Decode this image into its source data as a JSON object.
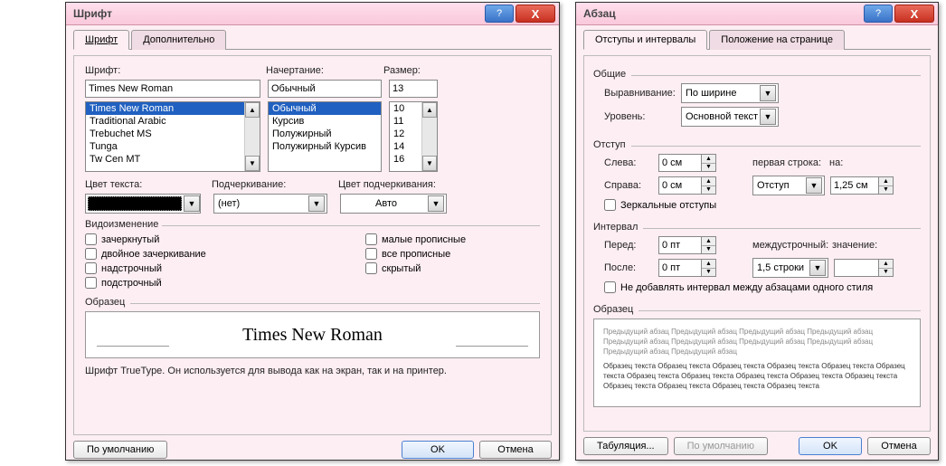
{
  "font_dialog": {
    "title": "Шрифт",
    "tabs": {
      "font": "Шрифт",
      "advanced": "Дополнительно"
    },
    "font_label": "Шрифт:",
    "style_label": "Начертание:",
    "size_label": "Размер:",
    "font_value": "Times New Roman",
    "style_value": "Обычный",
    "size_value": "13",
    "font_list": [
      "Times New Roman",
      "Traditional Arabic",
      "Trebuchet MS",
      "Tunga",
      "Tw Cen MT"
    ],
    "style_list": [
      "Обычный",
      "Курсив",
      "Полужирный",
      "Полужирный Курсив"
    ],
    "size_list": [
      "10",
      "11",
      "12",
      "14",
      "16"
    ],
    "text_color_label": "Цвет текста:",
    "underline_label": "Подчеркивание:",
    "underline_value": "(нет)",
    "underline_color_label": "Цвет подчеркивания:",
    "underline_color_value": "Авто",
    "effects_label": "Видоизменение",
    "effects_left": [
      "зачеркнутый",
      "двойное зачеркивание",
      "надстрочный",
      "подстрочный"
    ],
    "effects_right": [
      "малые прописные",
      "все прописные",
      "скрытый"
    ],
    "sample_label": "Образец",
    "sample_text": "Times New Roman",
    "truetype_note": "Шрифт TrueType. Он используется для вывода как на экран, так и на принтер.",
    "default_btn": "По умолчанию",
    "ok_btn": "OK",
    "cancel_btn": "Отмена"
  },
  "para_dialog": {
    "title": "Абзац",
    "tabs": {
      "indent": "Отступы и интервалы",
      "page": "Положение на странице"
    },
    "general_label": "Общие",
    "align_label": "Выравнивание:",
    "align_value": "По ширине",
    "level_label": "Уровень:",
    "level_value": "Основной текст",
    "indent_label": "Отступ",
    "left_label": "Слева:",
    "left_value": "0 см",
    "right_label": "Справа:",
    "right_value": "0 см",
    "firstline_label": "первая строка:",
    "firstline_value": "Отступ",
    "by_label": "на:",
    "by_value": "1,25 см",
    "mirror_label": "Зеркальные отступы",
    "spacing_label": "Интервал",
    "before_label": "Перед:",
    "before_value": "0 пт",
    "after_label": "После:",
    "after_value": "0 пт",
    "linesp_label": "междустрочный:",
    "linesp_value": "1,5 строки",
    "at_label": "значение:",
    "at_value": "",
    "nospace_label": "Не добавлять интервал между абзацами одного стиля",
    "sample_label": "Образец",
    "preview_light": "Предыдущий абзац Предыдущий абзац Предыдущий абзац Предыдущий абзац Предыдущий абзац Предыдущий абзац Предыдущий абзац Предыдущий абзац Предыдущий абзац Предыдущий абзац",
    "preview_dark": "Образец текста Образец текста Образец текста Образец текста Образец текста Образец текста Образец текста Образец текста Образец текста Образец текста Образец текста Образец текста Образец текста Образец текста Образец текста",
    "tabs_btn": "Табуляция...",
    "default_btn": "По умолчанию",
    "ok_btn": "OK",
    "cancel_btn": "Отмена"
  }
}
